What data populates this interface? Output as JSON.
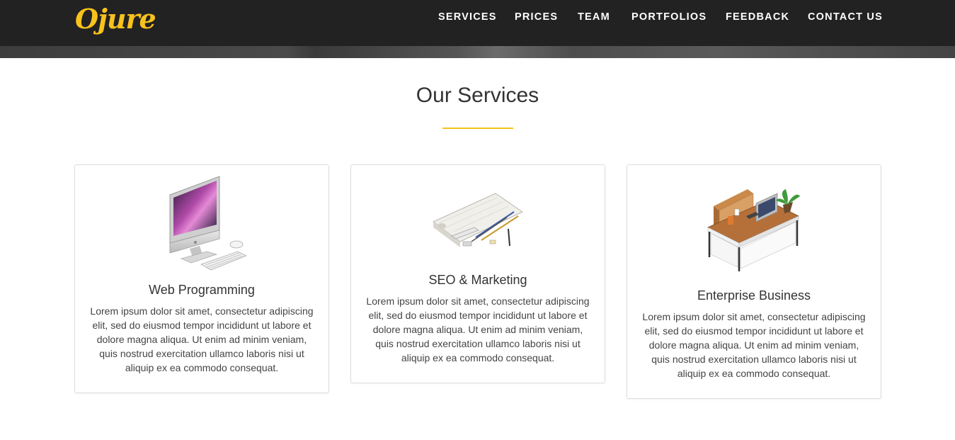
{
  "brand": {
    "logo_text": "Ojure",
    "accent": "#f8c21d"
  },
  "nav": {
    "items": [
      {
        "label": "SERVICES"
      },
      {
        "label": "PRICES"
      },
      {
        "label": "TEAM"
      },
      {
        "label": "PORTFOLIOS"
      },
      {
        "label": "FEEDBACK"
      },
      {
        "label": "CONTACT US"
      }
    ]
  },
  "services": {
    "title": "Our Services",
    "cards": [
      {
        "icon": "imac-computer-icon",
        "title": "Web Programming",
        "text": "Lorem ipsum dolor sit amet, consectetur adipiscing elit, sed do eiusmod tempor incididunt ut labore et dolore magna aliqua. Ut enim ad minim veniam, quis nostrud exercitation ullamco laboris nisi ut aliquip ex ea commodo consequat."
      },
      {
        "icon": "blueprint-pencils-icon",
        "title": "SEO & Marketing",
        "text": "Lorem ipsum dolor sit amet, consectetur adipiscing elit, sed do eiusmod tempor incididunt ut labore et dolore magna aliqua. Ut enim ad minim veniam, quis nostrud exercitation ullamco laboris nisi ut aliquip ex ea commodo consequat."
      },
      {
        "icon": "office-desk-icon",
        "title": "Enterprise Business",
        "text": "Lorem ipsum dolor sit amet, consectetur adipiscing elit, sed do eiusmod tempor incididunt ut labore et dolore magna aliqua. Ut enim ad minim veniam, quis nostrud exercitation ullamco laboris nisi ut aliquip ex ea commodo consequat."
      }
    ]
  }
}
